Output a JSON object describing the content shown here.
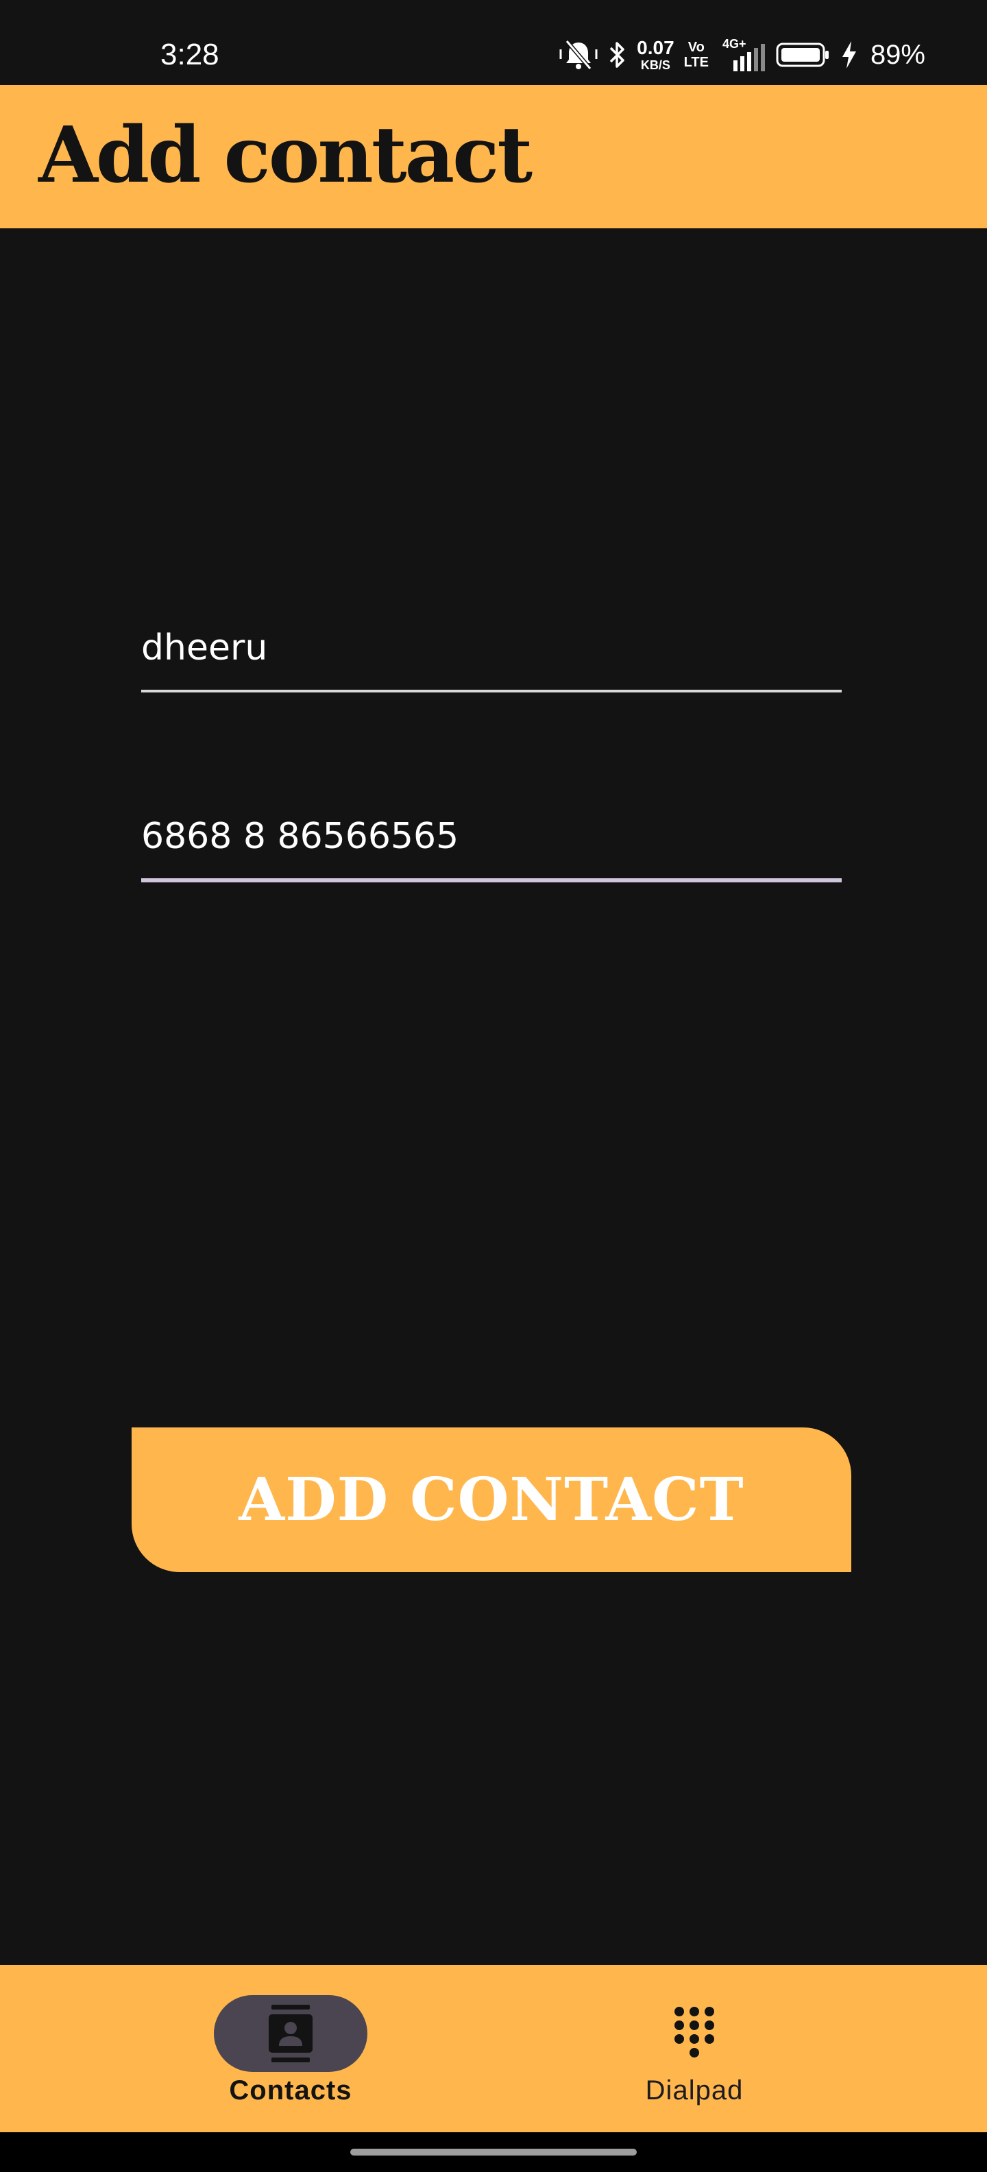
{
  "status_bar": {
    "time": "3:28",
    "net_speed_value": "0.07",
    "net_speed_unit": "KB/S",
    "volte_top": "Vo",
    "volte_bottom": "LTE",
    "network_type": "4G+",
    "battery_percent": "89%",
    "icons": [
      "mute-vibrate-icon",
      "bluetooth-icon",
      "signal-icon",
      "battery-icon",
      "charging-bolt-icon"
    ]
  },
  "app_bar": {
    "title": "Add contact"
  },
  "form": {
    "name_value": "dheeru",
    "phone_value": "6868 8 86566565"
  },
  "actions": {
    "add_contact_label": "ADD CONTACT"
  },
  "bottom_nav": {
    "items": [
      {
        "label": "Contacts",
        "icon": "contacts-icon",
        "selected": true
      },
      {
        "label": "Dialpad",
        "icon": "dialpad-icon",
        "selected": false
      }
    ]
  },
  "colors": {
    "accent": "#ffb74d",
    "background": "#131313",
    "indicator": "#4a4550"
  }
}
